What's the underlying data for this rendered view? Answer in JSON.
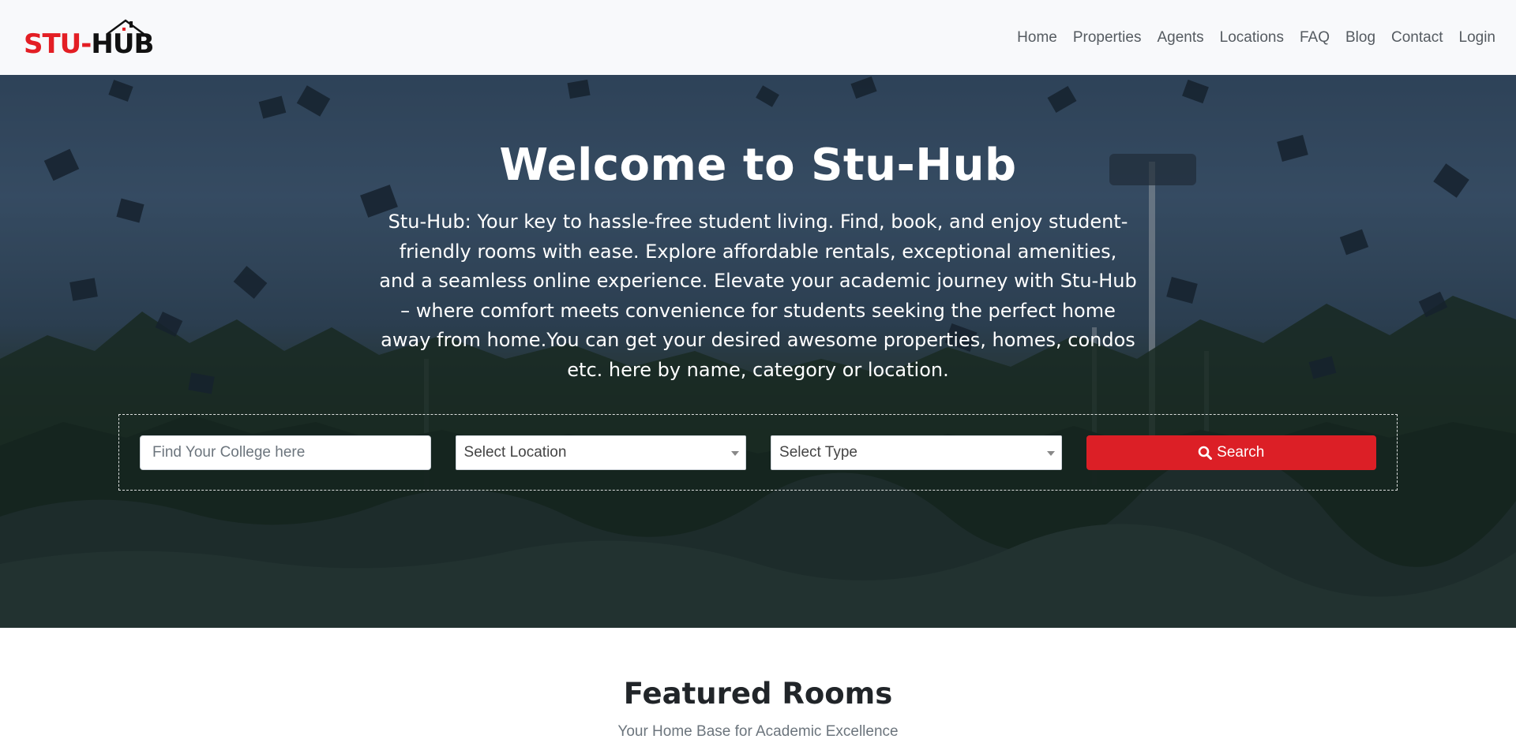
{
  "brand": {
    "logo_part1": "STU-",
    "logo_part2": "HUB",
    "logo_red": "#e31e24"
  },
  "nav": {
    "items": [
      "Home",
      "Properties",
      "Agents",
      "Locations",
      "FAQ",
      "Blog",
      "Contact",
      "Login"
    ]
  },
  "hero": {
    "title": "Welcome to Stu-Hub",
    "description": "Stu-Hub: Your key to hassle-free student living. Find, book, and enjoy student-friendly rooms with ease. Explore affordable rentals, exceptional amenities, and a seamless online experience. Elevate your academic journey with Stu-Hub – where comfort meets convenience for students seeking the perfect home away from home.You can get your desired awesome properties, homes, condos etc. here by name, category or location."
  },
  "search": {
    "college_placeholder": "Find Your College here",
    "location_selected": "Select Location",
    "type_selected": "Select Type",
    "button_label": "Search",
    "button_icon": "search-icon",
    "button_color": "#dc1f26"
  },
  "featured": {
    "title": "Featured Rooms",
    "subtitle": "Your Home Base for Academic Excellence"
  }
}
